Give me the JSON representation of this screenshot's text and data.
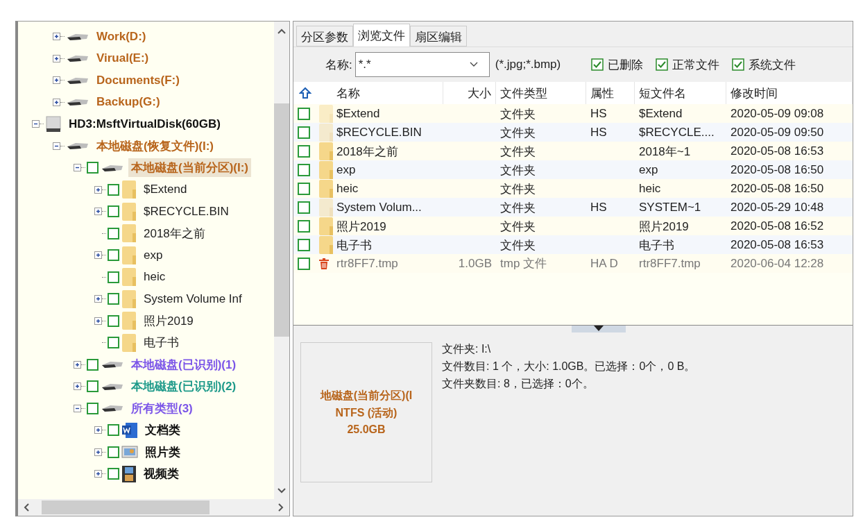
{
  "tree": {
    "items": [
      {
        "label": "Work(D:)",
        "kind": "drive",
        "expanded": false,
        "selected": false,
        "color": "#b8651c"
      },
      {
        "label": "Virual(E:)",
        "kind": "drive",
        "expanded": false,
        "selected": false,
        "color": "#b8651c"
      },
      {
        "label": "Documents(F:)",
        "kind": "drive",
        "expanded": false,
        "selected": false,
        "color": "#b8651c"
      },
      {
        "label": "Backup(G:)",
        "kind": "drive",
        "expanded": false,
        "selected": false,
        "color": "#b8651c"
      },
      {
        "label": "HD3:MsftVirtualDisk(60GB)",
        "kind": "disk",
        "expanded": true,
        "selected": false,
        "color": "#111111",
        "children": [
          {
            "label": "本地磁盘(恢复文件)(I:)",
            "kind": "drive",
            "expanded": true,
            "selected": false,
            "color": "#b8651c",
            "children": [
              {
                "label": "本地磁盘(当前分区)(I:)",
                "kind": "drive",
                "expanded": true,
                "checked": false,
                "selected": true,
                "color": "#b8651c",
                "children": [
                  {
                    "label": "$Extend",
                    "kind": "folder",
                    "expanded": false,
                    "checked": false,
                    "selected": false,
                    "color": "#222222"
                  },
                  {
                    "label": "$RECYCLE.BIN",
                    "kind": "folder",
                    "expanded": false,
                    "checked": false,
                    "selected": false,
                    "color": "#222222"
                  },
                  {
                    "label": "2018年之前",
                    "kind": "folder",
                    "checked": false,
                    "selected": false,
                    "color": "#222222"
                  },
                  {
                    "label": "exp",
                    "kind": "folder",
                    "expanded": false,
                    "checked": false,
                    "selected": false,
                    "color": "#222222"
                  },
                  {
                    "label": "heic",
                    "kind": "folder",
                    "checked": false,
                    "selected": false,
                    "color": "#222222"
                  },
                  {
                    "label": "System Volume Inf",
                    "kind": "folder",
                    "expanded": false,
                    "checked": false,
                    "selected": false,
                    "color": "#222222"
                  },
                  {
                    "label": "照片2019",
                    "kind": "folder",
                    "expanded": false,
                    "checked": false,
                    "selected": false,
                    "color": "#222222"
                  },
                  {
                    "label": "电子书",
                    "kind": "folder",
                    "checked": false,
                    "selected": false,
                    "color": "#222222"
                  }
                ]
              },
              {
                "label": "本地磁盘(已识别)(1)",
                "kind": "drive",
                "expanded": false,
                "checked": false,
                "selected": false,
                "color": "#7b55e8"
              },
              {
                "label": "本地磁盘(已识别)(2)",
                "kind": "drive",
                "expanded": false,
                "checked": false,
                "selected": false,
                "color": "#1e9a8a"
              },
              {
                "label": "所有类型(3)",
                "kind": "drive",
                "expanded": true,
                "checked": false,
                "selected": false,
                "color": "#7b55e8",
                "children": [
                  {
                    "label": "文档类",
                    "kind": "doc",
                    "expanded": false,
                    "checked": false,
                    "selected": false,
                    "color": "#111111"
                  },
                  {
                    "label": "照片类",
                    "kind": "photo",
                    "expanded": false,
                    "checked": false,
                    "selected": false,
                    "color": "#111111"
                  },
                  {
                    "label": "视频类",
                    "kind": "video",
                    "expanded": false,
                    "checked": false,
                    "selected": false,
                    "color": "#111111"
                  }
                ]
              }
            ]
          }
        ]
      }
    ]
  },
  "tabs": [
    {
      "label": "分区参数",
      "selected": false
    },
    {
      "label": "浏览文件",
      "selected": true
    },
    {
      "label": "扇区编辑",
      "selected": false
    }
  ],
  "filter": {
    "label": "名称:",
    "value": "*.*",
    "hint": "(*.jpg;*.bmp)",
    "options": [
      {
        "label": "已删除",
        "checked": true
      },
      {
        "label": "正常文件",
        "checked": true
      },
      {
        "label": "系统文件",
        "checked": true
      }
    ]
  },
  "table": {
    "columns": [
      "名称",
      "大小",
      "文件类型",
      "属性",
      "短文件名",
      "修改时间"
    ],
    "rows": [
      {
        "checked": false,
        "kind": "folder",
        "hidden": true,
        "name": "$Extend",
        "type": "文件夹",
        "attr": "HS",
        "short": "$Extend",
        "modified": "2020-05-09 09:08"
      },
      {
        "checked": false,
        "kind": "folder",
        "hidden": true,
        "name": "$RECYCLE.BIN",
        "type": "文件夹",
        "attr": "HS",
        "short": "$RECYCLE....",
        "modified": "2020-05-09 09:50"
      },
      {
        "checked": false,
        "kind": "folder",
        "hidden": false,
        "name": "2018年之前",
        "type": "文件夹",
        "short": "2018年~1",
        "modified": "2020-05-08 16:53"
      },
      {
        "checked": false,
        "kind": "folder",
        "hidden": false,
        "name": "exp",
        "type": "文件夹",
        "short": "exp",
        "modified": "2020-05-08 16:50"
      },
      {
        "checked": false,
        "kind": "folder",
        "hidden": false,
        "name": "heic",
        "type": "文件夹",
        "short": "heic",
        "modified": "2020-05-08 16:50"
      },
      {
        "checked": false,
        "kind": "folder",
        "hidden": true,
        "name": "System Volum...",
        "type": "文件夹",
        "attr": "HS",
        "short": "SYSTEM~1",
        "modified": "2020-05-29 10:48"
      },
      {
        "checked": false,
        "kind": "folder",
        "hidden": false,
        "name": "照片2019",
        "type": "文件夹",
        "short": "照片2019",
        "modified": "2020-05-08 16:52"
      },
      {
        "checked": false,
        "kind": "folder",
        "hidden": false,
        "name": "电子书",
        "type": "文件夹",
        "short": "电子书",
        "modified": "2020-05-08 16:53"
      },
      {
        "checked": false,
        "kind": "deleted",
        "hidden": false,
        "name": "rtr8FF7.tmp",
        "size": "1.0GB",
        "type": "tmp 文件",
        "attr": "HA D",
        "short": "rtr8FF7.tmp",
        "modified": "2020-06-04 12:28"
      }
    ]
  },
  "volume_card": [
    "地磁盘(当前分区)(I",
    "NTFS (活动)",
    "25.0GB"
  ],
  "info_lines": [
    "文件夹: I:\\",
    "文件数目: 1 个，大小: 1.0GB。已选择：0个，0 B。",
    "文件夹数目: 8，已选择：0个。"
  ]
}
